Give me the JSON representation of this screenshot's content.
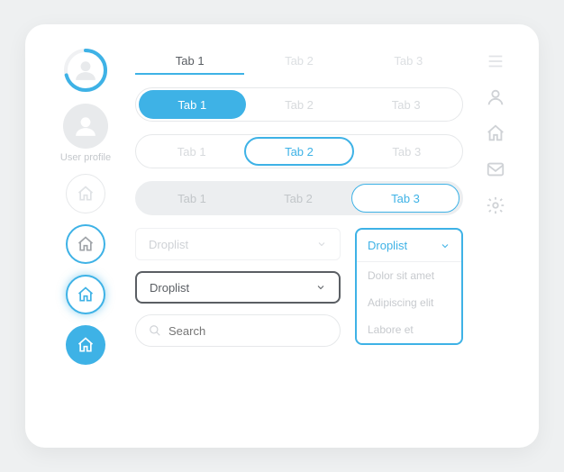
{
  "colors": {
    "accent": "#3eb2e6",
    "muted": "#cfd2d6",
    "text": "#5a5e63"
  },
  "left": {
    "user_label": "User profile"
  },
  "tabs": {
    "row1": [
      "Tab 1",
      "Tab 2",
      "Tab 3"
    ],
    "row2": [
      "Tab 1",
      "Tab 2",
      "Tab 3"
    ],
    "row3": [
      "Tab 1",
      "Tab 2",
      "Tab 3"
    ],
    "row4": [
      "Tab 1",
      "Tab 2",
      "Tab 3"
    ],
    "active": {
      "row1": 0,
      "row2": 0,
      "row3": 1,
      "row4": 2
    }
  },
  "droplists": {
    "ghost_label": "Droplist",
    "bold_label": "Droplist",
    "open_label": "Droplist",
    "open_items": [
      "Dolor sit amet",
      "Adipiscing elit",
      "Labore et"
    ]
  },
  "search": {
    "placeholder": "Search"
  },
  "right_icons": [
    "menu-icon",
    "user-icon",
    "home-icon",
    "mail-icon",
    "gear-icon"
  ]
}
